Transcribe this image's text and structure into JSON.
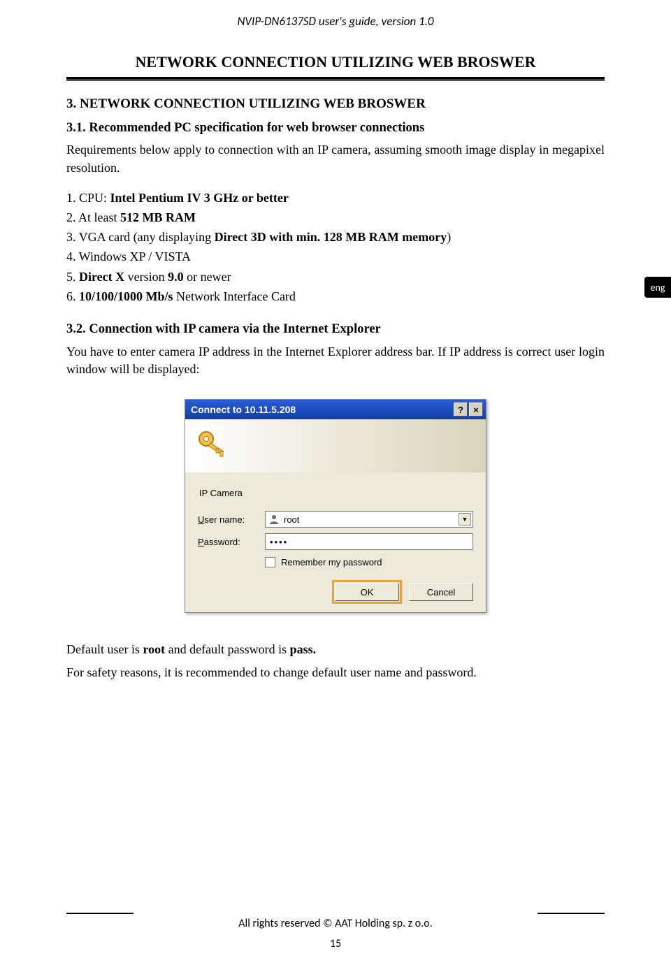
{
  "header": {
    "doc_title": "NVIP-DN6137SD user's guide, version 1.0"
  },
  "section_title": "NETWORK CONNECTION UTILIZING WEB BROSWER",
  "s3": {
    "h": "3. NETWORK CONNECTION UTILIZING WEB BROSWER",
    "s31h": "3.1. Recommended PC specification for web browser connections",
    "s31p": "Requirements below    apply to connection with an IP camera, assuming smooth image display in megapixel resolution.",
    "specs": {
      "l1a": "1. CPU: ",
      "l1b": "Intel Pentium IV 3 GHz or better",
      "l2a": "2. At least ",
      "l2b": "512 MB RAM",
      "l3a": "3. VGA card (any displaying ",
      "l3b": "Direct 3D with min. 128 MB RAM memory",
      "l3c": ")",
      "l4": "4. Windows XP / VISTA",
      "l5a": "5. ",
      "l5b": "Direct X ",
      "l5c": "version ",
      "l5d": "9.0 ",
      "l5e": "or newer",
      "l6a": "6. ",
      "l6b": "10/100/1000 Mb/s ",
      "l6c": "Network Interface Card"
    },
    "s32h": "3.2. Connection with IP camera via the Internet Explorer",
    "s32p": "You have to enter camera IP address in the Internet Explorer address bar. If IP address is correct user login window will be displayed:"
  },
  "lang_tab": "eng",
  "dialog": {
    "title": "Connect to 10.11.5.208",
    "help_glyph": "?",
    "close_glyph": "×",
    "prompt": "IP Camera",
    "user_label_pre": "U",
    "user_label_post": "ser name:",
    "pass_label_pre": "P",
    "pass_label_post": "assword:",
    "user_value": "root",
    "pass_value": "••••",
    "remember": "Remember my password",
    "ok": "OK",
    "cancel": "Cancel"
  },
  "tail": {
    "p1a": "Default user is ",
    "p1b": "root ",
    "p1c": "and default password is ",
    "p1d": "pass.",
    "p2": "For safety reasons, it is recommended to change default user name and password."
  },
  "footer": {
    "rights": "All rights reserved © AAT Holding sp. z o.o.",
    "page": "15"
  }
}
